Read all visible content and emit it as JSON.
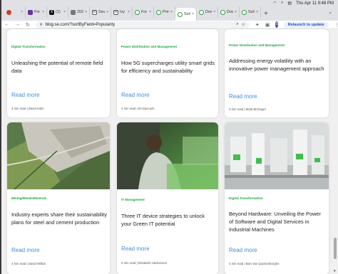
{
  "menubar": {
    "time": "Thu Apr 11 9:48 PM"
  },
  "tabs": [
    {
      "icon": "red-dot-icon",
      "title": ""
    },
    {
      "icon": "purple-e-icon",
      "title": "Fin"
    },
    {
      "icon": "x-logo-icon",
      "title": "(1)"
    },
    {
      "icon": "gray-icon",
      "title": "202"
    },
    {
      "icon": "wikipedia-icon",
      "title": "Sev"
    },
    {
      "icon": "wikipedia-icon",
      "title": "Ivy"
    },
    {
      "icon": "green-circle-icon",
      "title": "Fin"
    },
    {
      "icon": "green-circle-icon",
      "title": "Prin"
    },
    {
      "icon": "green-circle-icon",
      "title": "Sch",
      "active": true
    },
    {
      "icon": "green-circle-icon",
      "title": "Dow"
    },
    {
      "icon": "green-circle-icon",
      "title": "Dow"
    },
    {
      "icon": "green-circle-icon",
      "title": "Sch"
    }
  ],
  "address": {
    "url": "blog.se.com/?sortByField=Popularity",
    "relaunch": "Relaunch to update",
    "avatar": "S"
  },
  "top_cards": [
    {
      "category": "Digital Transformation",
      "title": "Unleashing the potential of remote field data",
      "more": "Read more",
      "meta": "4 min read | David Kidd"
    },
    {
      "category": "Power Distribution and Management",
      "title": "How 5G supercharges utility smart grids for efficiency and sustainability",
      "more": "Read more",
      "meta": "4 min read | Eli Daccach"
    },
    {
      "category": "Power Distribution and Management",
      "title": "Addressing energy volatility with an innovative power management approach",
      "more": "Read more",
      "meta": "3 min read | Mark Bickinger"
    }
  ],
  "bottom_cards": [
    {
      "category": "Mining/Metals/Minerals",
      "title": "Industry experts share their sustainability plans for steel and cement production",
      "more": "Read more",
      "meta": "4 min read | David Willick"
    },
    {
      "category": "IT Management",
      "title": "Three IT device strategies to unlock your Green IT potential",
      "more": "Read more",
      "meta": "5 min read | Elizabeth Hackenson"
    },
    {
      "category": "Digital Transformation",
      "title": "Beyond Hardware: Unveiling the Power of Software and Digital Services in Industrial Machines",
      "more": "Read more",
      "meta": "4 min read | Bart Van Quickenborghe"
    }
  ]
}
